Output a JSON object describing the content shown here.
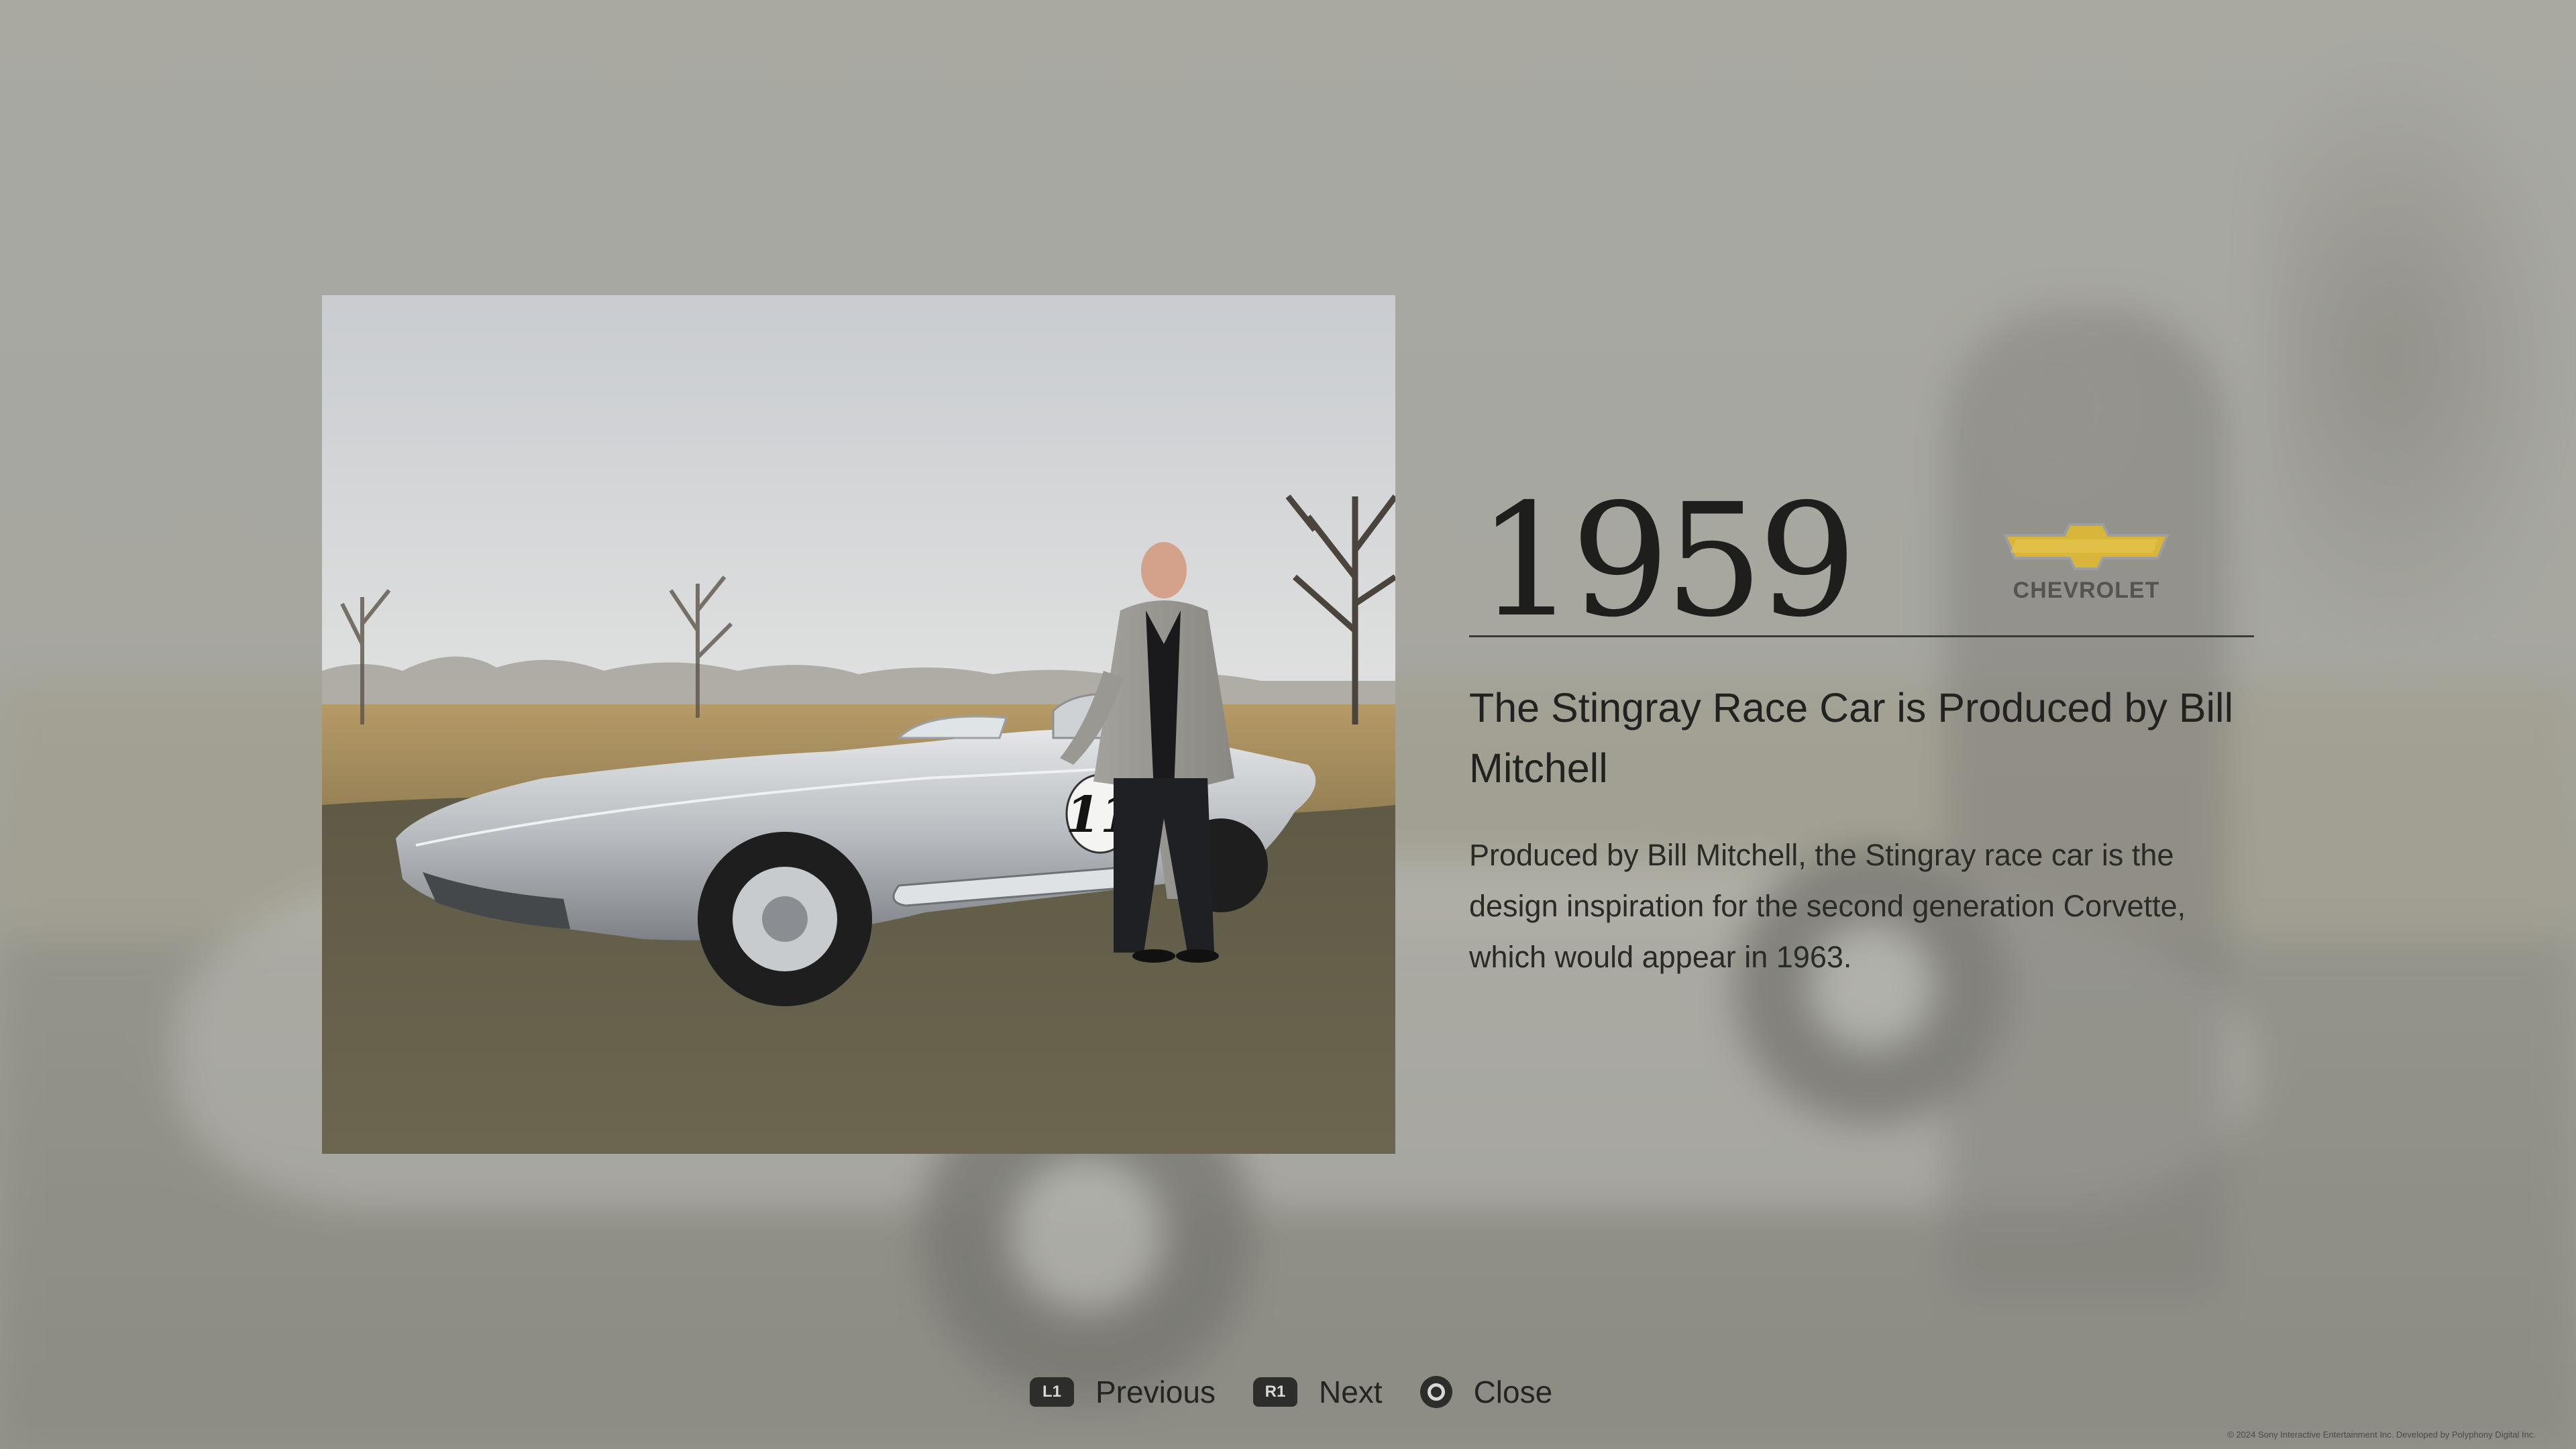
{
  "entry": {
    "year": "1959",
    "brand": {
      "name": "CHEVROLET",
      "logo_icon": "chevrolet-bowtie-icon",
      "logo_color": "#d9b53a"
    },
    "headline": "The Stingray Race Car is Produced by Bill Mitchell",
    "body": "Produced by Bill Mitchell, the Stingray race car is the design inspiration for the second generation Corvette, which would appear in 1963.",
    "photo": {
      "race_number": "11"
    }
  },
  "controls": {
    "previous": {
      "badge": "L1",
      "label": "Previous"
    },
    "next": {
      "badge": "R1",
      "label": "Next"
    },
    "close": {
      "icon": "circle-button-icon",
      "label": "Close"
    }
  },
  "footer": {
    "copyright": "© 2024 Sony Interactive Entertainment Inc. Developed by Polyphony Digital Inc."
  }
}
